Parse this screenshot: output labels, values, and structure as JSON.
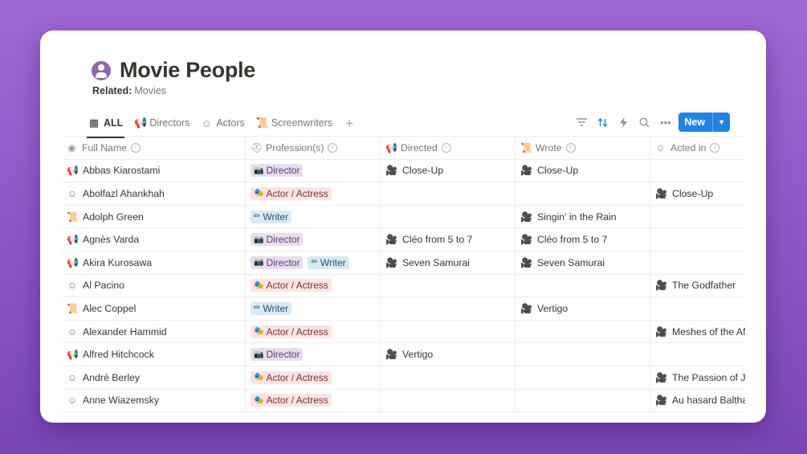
{
  "page": {
    "title": "Movie People",
    "related_label": "Related:",
    "related_value": "Movies"
  },
  "tabs": [
    {
      "label": "ALL",
      "icon": "table-icon",
      "active": true
    },
    {
      "label": "Directors",
      "icon": "megaphone-icon"
    },
    {
      "label": "Actors",
      "icon": "theater-mask-icon"
    },
    {
      "label": "Screenwriters",
      "icon": "script-icon"
    }
  ],
  "toolbar": {
    "new_label": "New",
    "accent_color": "#2383e2"
  },
  "columns": [
    {
      "label": "Full Name",
      "icon": "person-icon"
    },
    {
      "label": "Profession(s)",
      "icon": "hat-icon"
    },
    {
      "label": "Directed",
      "icon": "megaphone-icon"
    },
    {
      "label": "Wrote",
      "icon": "script-icon"
    },
    {
      "label": "Acted in",
      "icon": "theater-mask-icon"
    }
  ],
  "tag_labels": {
    "director": "Director",
    "actor": "Actor / Actress",
    "writer": "Writer"
  },
  "rows": [
    {
      "name": "Abbas Kiarostami",
      "type": "director",
      "tags": [
        "director"
      ],
      "directed": "Close-Up",
      "wrote": "Close-Up",
      "acted": ""
    },
    {
      "name": "Abolfazl Ahankhah",
      "type": "actor",
      "tags": [
        "actor"
      ],
      "directed": "",
      "wrote": "",
      "acted": "Close-Up"
    },
    {
      "name": "Adolph Green",
      "type": "writer",
      "tags": [
        "writer"
      ],
      "directed": "",
      "wrote": "Singin’ in the Rain",
      "acted": ""
    },
    {
      "name": "Agnès Varda",
      "type": "director",
      "tags": [
        "director"
      ],
      "directed": "Cléo from 5 to 7",
      "wrote": "Cléo from 5 to 7",
      "acted": ""
    },
    {
      "name": "Akira Kurosawa",
      "type": "director",
      "tags": [
        "director",
        "writer"
      ],
      "directed": "Seven Samurai",
      "wrote": "Seven Samurai",
      "acted": ""
    },
    {
      "name": "Al Pacino",
      "type": "actor",
      "tags": [
        "actor"
      ],
      "directed": "",
      "wrote": "",
      "acted": "The Godfather"
    },
    {
      "name": "Alec Coppel",
      "type": "writer",
      "tags": [
        "writer"
      ],
      "directed": "",
      "wrote": "Vertigo",
      "acted": ""
    },
    {
      "name": "Alexander Hammid",
      "type": "actor",
      "tags": [
        "actor"
      ],
      "directed": "",
      "wrote": "",
      "acted": "Meshes of the Af"
    },
    {
      "name": "Alfred Hitchcock",
      "type": "director",
      "tags": [
        "director"
      ],
      "directed": "Vertigo",
      "wrote": "",
      "acted": ""
    },
    {
      "name": "André Berley",
      "type": "actor",
      "tags": [
        "actor"
      ],
      "directed": "",
      "wrote": "",
      "acted": "The Passion of J"
    },
    {
      "name": "Anne Wiazemsky",
      "type": "actor",
      "tags": [
        "actor"
      ],
      "directed": "",
      "wrote": "",
      "acted": "Au hasard Baltha"
    }
  ]
}
